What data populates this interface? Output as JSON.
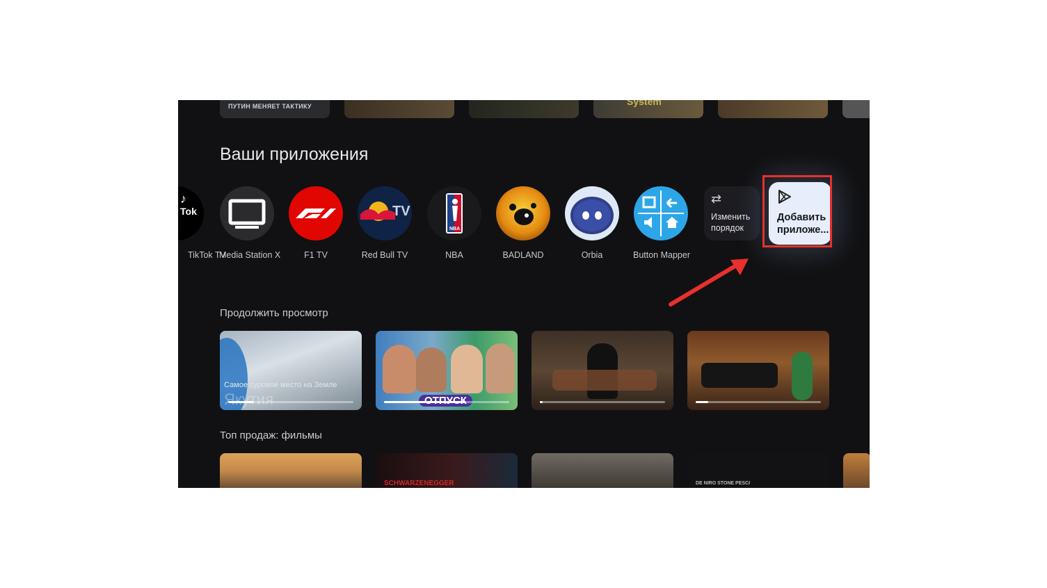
{
  "top_strip": {
    "thumb1_caption": "ПУТИН МЕНЯЕТ ТАКТИКУ",
    "thumb4_caption": "System"
  },
  "apps_section": {
    "title": "Ваши приложения",
    "apps": [
      {
        "label": "TikTok TV",
        "icon": "tiktok-icon"
      },
      {
        "label": "Media Station X",
        "icon": "monitor-icon"
      },
      {
        "label": "F1 TV",
        "icon": "f1-logo-icon"
      },
      {
        "label": "Red Bull TV",
        "icon": "redbull-tv-icon"
      },
      {
        "label": "NBA",
        "icon": "nba-logo-icon"
      },
      {
        "label": "BADLAND",
        "icon": "badland-icon"
      },
      {
        "label": "Orbia",
        "icon": "orbia-icon"
      },
      {
        "label": "Button Mapper",
        "icon": "button-mapper-icon"
      }
    ],
    "reorder": {
      "label_line1": "Изменить",
      "label_line2": "порядок",
      "icon": "swap-arrows-icon"
    },
    "add_app": {
      "label_line1": "Добавить",
      "label_line2": "приложе...",
      "icon": "play-store-icon"
    }
  },
  "continue_watching": {
    "title": "Продолжить просмотр",
    "cards": [
      {
        "subtitle": "Самое суровое место на Земле",
        "title_overlay": "Якутия",
        "progress": 0.2
      },
      {
        "title_overlay": "ОТПУСК",
        "progress": 0.65
      },
      {
        "progress": 0.02
      },
      {
        "progress": 0.1
      }
    ]
  },
  "top_sales": {
    "title": "Топ продаж: фильмы",
    "films": [
      {
        "caption": ""
      },
      {
        "caption": "SCHWARZENEGGER"
      },
      {
        "caption": ""
      },
      {
        "caption": "DE NIRO   STONE   PESCI"
      }
    ]
  },
  "colors": {
    "background": "#111113",
    "highlight_box": "#e8302d",
    "annotation_arrow": "#e8302d",
    "add_app_tile": "#e6eefb"
  }
}
